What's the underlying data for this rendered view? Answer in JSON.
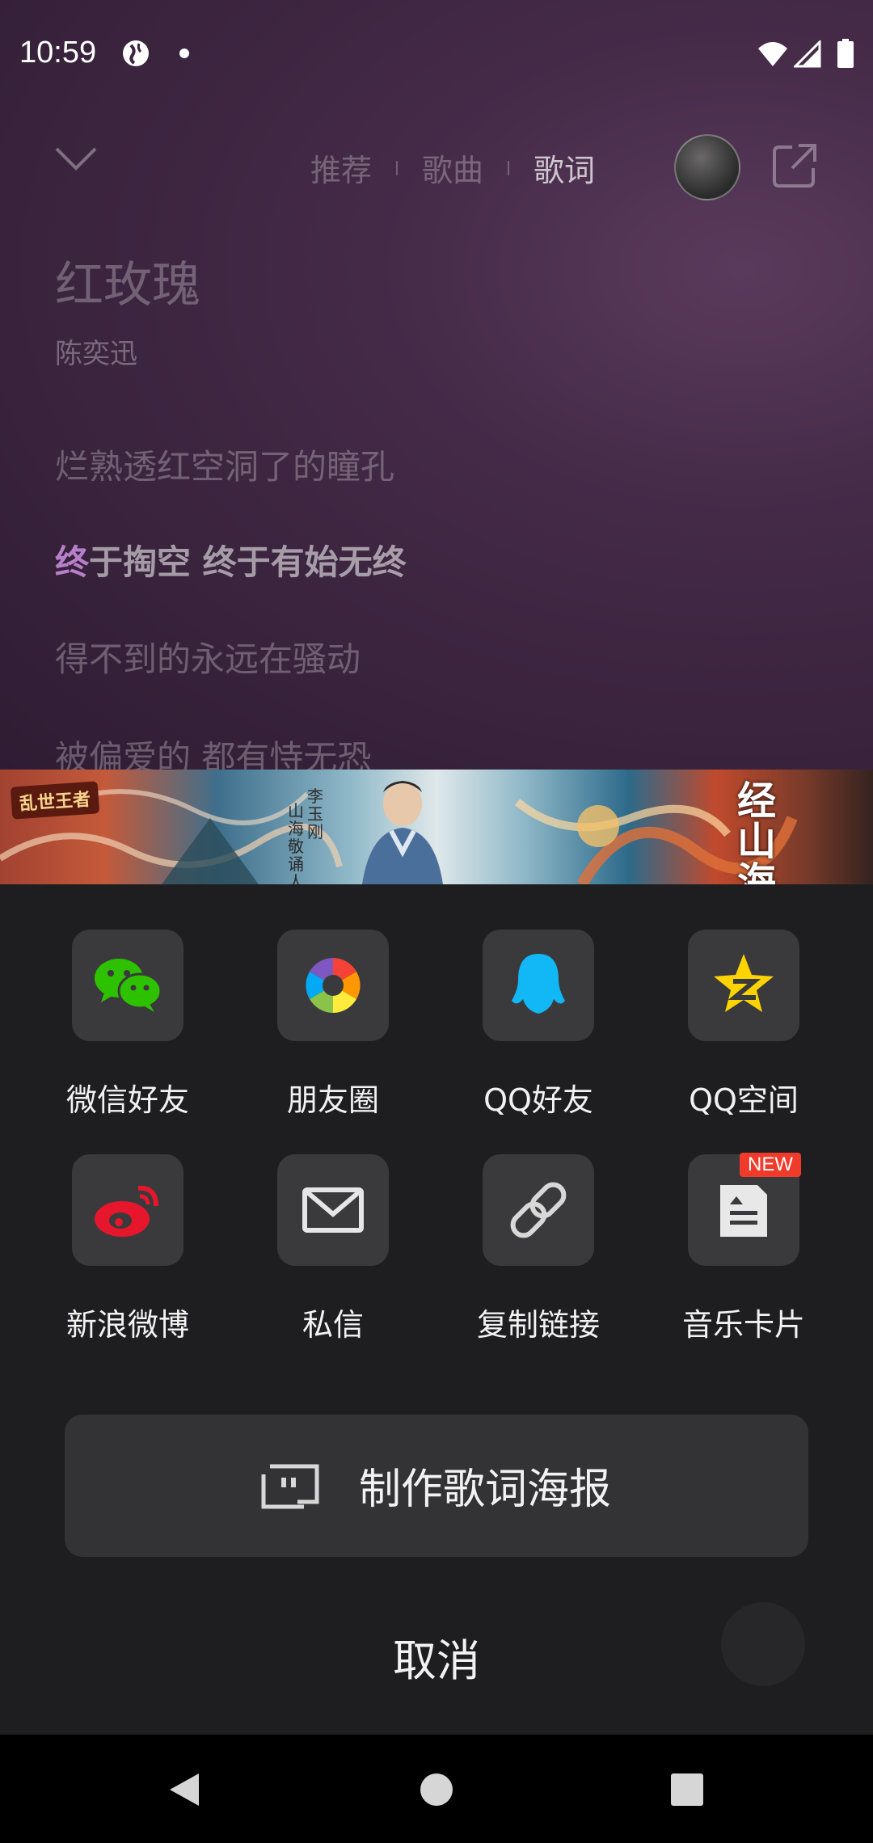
{
  "status_bar": {
    "time": "10:59"
  },
  "player": {
    "tabs": [
      "推荐",
      "歌曲",
      "歌词"
    ],
    "active_tab": "歌词",
    "song_title": "红玫瑰",
    "artist": "陈奕迅",
    "lyrics": [
      "烂熟透红空洞了的瞳孔",
      "终于掏空 终于有始无终",
      "得不到的永远在骚动",
      "被偏爱的 都有恃无恐"
    ],
    "current_line_highlight": "终",
    "current_line_rest": "于掏空 终于有始无终"
  },
  "ad_banner": {
    "left_logo": "乱世王者",
    "vertical_text_a": "李玉刚",
    "vertical_text_b": "山海敬诵人",
    "right_brand": "经山海"
  },
  "share_sheet": {
    "row1": [
      {
        "label": "微信好友",
        "icon": "wechat-icon"
      },
      {
        "label": "朋友圈",
        "icon": "moments-icon"
      },
      {
        "label": "QQ好友",
        "icon": "qq-icon"
      },
      {
        "label": "QQ空间",
        "icon": "qzone-icon"
      }
    ],
    "row2": [
      {
        "label": "新浪微博",
        "icon": "weibo-icon"
      },
      {
        "label": "私信",
        "icon": "mail-icon"
      },
      {
        "label": "复制链接",
        "icon": "link-icon"
      },
      {
        "label": "音乐卡片",
        "icon": "music-card-icon",
        "badge": "NEW"
      }
    ],
    "poster_button": "制作歌词海报",
    "cancel": "取消"
  },
  "colors": {
    "sheet_bg": "#1e1e20",
    "tile_bg": "#3a3a3c",
    "wechat_green": "#2dc100",
    "qq_blue": "#12b7f5",
    "qzone_yellow": "#fdd300",
    "weibo_red": "#e6162d",
    "badge_red": "#f03a2a",
    "lyric_highlight": "#b77fc9"
  }
}
